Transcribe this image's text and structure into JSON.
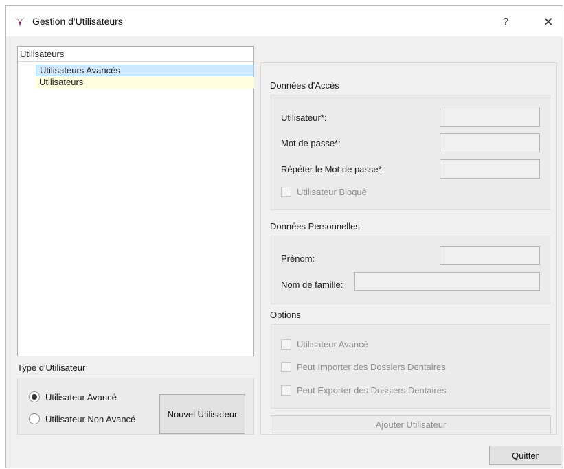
{
  "window": {
    "title": "Gestion d'Utilisateurs",
    "help_label": "?",
    "close_label": "✕",
    "accent_color": "#8b1a5a"
  },
  "tree": {
    "header": "Utilisateurs",
    "items": [
      {
        "label": "Utilisateurs Avancés",
        "selected": true
      },
      {
        "label": "Utilisateurs",
        "selected": false
      }
    ]
  },
  "user_type": {
    "title": "Type d'Utilisateur",
    "options": [
      {
        "label": "Utilisateur Avancé",
        "checked": true
      },
      {
        "label": "Utilisateur Non Avancé",
        "checked": false
      }
    ],
    "new_user_button": "Nouvel Utilisateur"
  },
  "access": {
    "title": "Données d'Accès",
    "user_label": "Utilisateur*:",
    "user_value": "",
    "password_label": "Mot de passe*:",
    "password_value": "",
    "repeat_label": "Répéter le Mot de passe*:",
    "repeat_value": "",
    "blocked_label": "Utilisateur Bloqué"
  },
  "personal": {
    "title": "Données Personnelles",
    "first_name_label": "Prénom:",
    "first_name_value": "",
    "last_name_label": "Nom de famille:",
    "last_name_value": ""
  },
  "options": {
    "title": "Options",
    "advanced_label": "Utilisateur Avancé",
    "import_label": "Peut Importer des Dossiers Dentaires",
    "export_label": "Peut Exporter des Dossiers Dentaires"
  },
  "add_user_button": "Ajouter Utilisateur",
  "quit_button": "Quitter"
}
